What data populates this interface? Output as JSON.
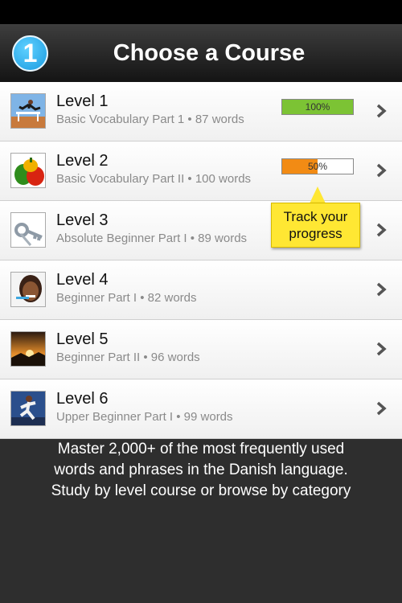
{
  "header": {
    "step_number": "1",
    "title": "Choose a Course"
  },
  "courses": [
    {
      "title": "Level 1",
      "subtitle": "Basic Vocabulary Part 1 • 87 words",
      "thumb": "hurdler-photo",
      "progress": {
        "percent": 100,
        "label": "100%",
        "color": "#7cc334"
      }
    },
    {
      "title": "Level 2",
      "subtitle": "Basic Vocabulary Part II • 100 words",
      "thumb": "peppers-photo",
      "progress": {
        "percent": 50,
        "label": "50%",
        "color": "#f28b14"
      }
    },
    {
      "title": "Level 3",
      "subtitle": "Absolute Beginner Part I • 89 words",
      "thumb": "keys-photo"
    },
    {
      "title": "Level 4",
      "subtitle": "Beginner Part I • 82 words",
      "thumb": "woman-toothbrush-photo"
    },
    {
      "title": "Level 5",
      "subtitle": "Beginner Part II • 96 words",
      "thumb": "sunset-photo"
    },
    {
      "title": "Level 6",
      "subtitle": "Upper Beginner Part I • 99 words",
      "thumb": "runner-photo"
    }
  ],
  "tooltip": {
    "line1": "Track your",
    "line2": "progress",
    "color": "#ffe733"
  },
  "footer": {
    "line1": "Master 2,000+ of the most frequently used",
    "line2": "words and phrases in the Danish language.",
    "line3": "Study by level course or browse by category"
  }
}
